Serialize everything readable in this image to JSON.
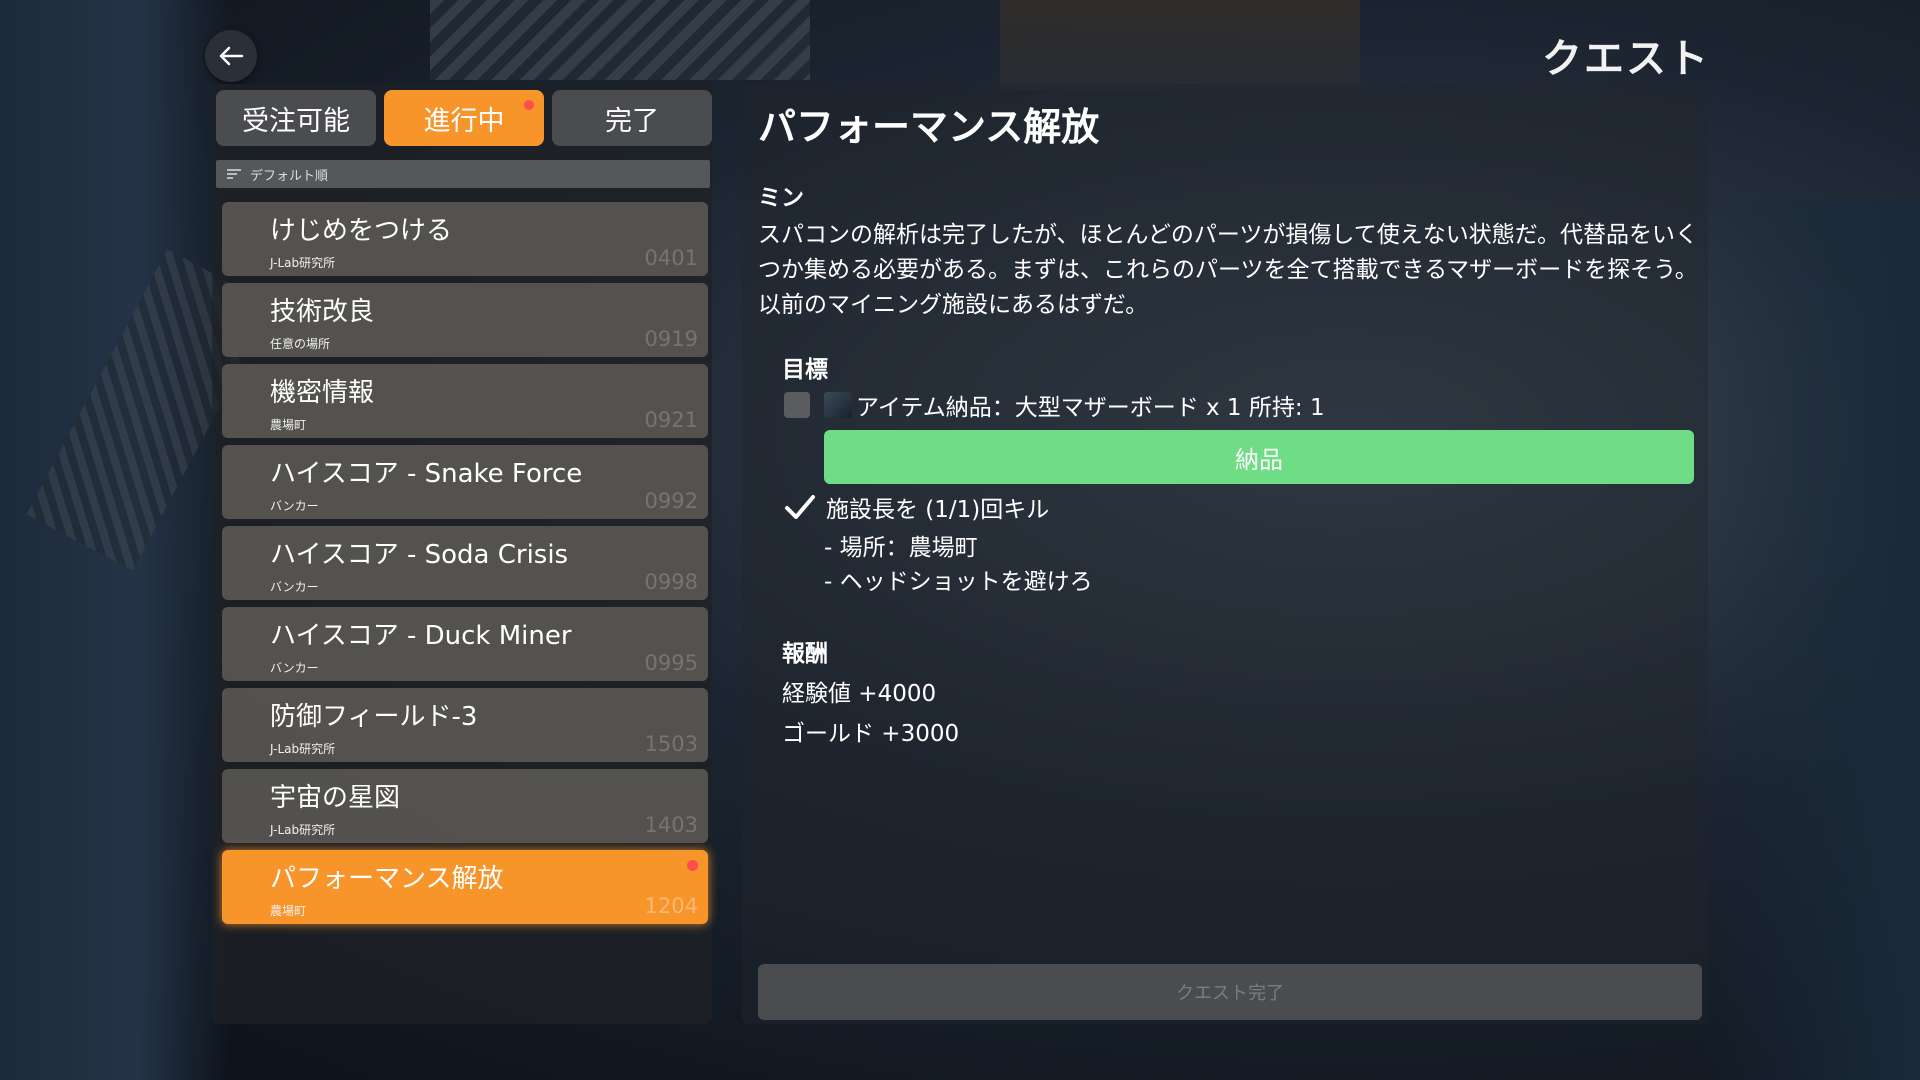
{
  "screen_title": "クエスト",
  "tabs": [
    {
      "label": "受注可能"
    },
    {
      "label": "進行中"
    },
    {
      "label": "完了"
    }
  ],
  "sort_label": "デフォルト順",
  "quests": [
    {
      "title": "けじめをつける",
      "location": "J-Lab研究所",
      "number": "0401"
    },
    {
      "title": "技術改良",
      "location": "任意の場所",
      "number": "0919"
    },
    {
      "title": "機密情報",
      "location": "農場町",
      "number": "0921"
    },
    {
      "title": "ハイスコア - Snake Force",
      "location": "バンカー",
      "number": "0992"
    },
    {
      "title": "ハイスコア - Soda Crisis",
      "location": "バンカー",
      "number": "0998"
    },
    {
      "title": "ハイスコア - Duck Miner",
      "location": "バンカー",
      "number": "0995"
    },
    {
      "title": "防御フィールド-3",
      "location": "J-Lab研究所",
      "number": "1503"
    },
    {
      "title": "宇宙の星図",
      "location": "J-Lab研究所",
      "number": "1403"
    },
    {
      "title": "パフォーマンス解放",
      "location": "農場町",
      "number": "1204"
    }
  ],
  "detail": {
    "title": "パフォーマンス解放",
    "giver": "ミン",
    "description": "スパコンの解析は完了したが、ほとんどのパーツが損傷して使えない状態だ。代替品をいくつか集める必要がある。まずは、これらのパーツを全て搭載できるマザーボードを探そう。以前のマイニング施設にあるはずだ。",
    "objectives_label": "目標",
    "objective1": "アイテム納品：大型マザーボード x 1 所持: 1",
    "deliver_button": "納品",
    "objective2": "施設長を (1/1)回キル",
    "objective2_sub1": "- 場所：農場町",
    "objective2_sub2": "- ヘッドショットを避けろ",
    "reward_label": "報酬",
    "reward1": "経験値 +4000",
    "reward2": "ゴールド +3000",
    "complete_button": "クエスト完了"
  },
  "colors": {
    "accent": "#f7942a",
    "deliver": "#6fdc86",
    "notify_dot": "#ff4d4d"
  }
}
